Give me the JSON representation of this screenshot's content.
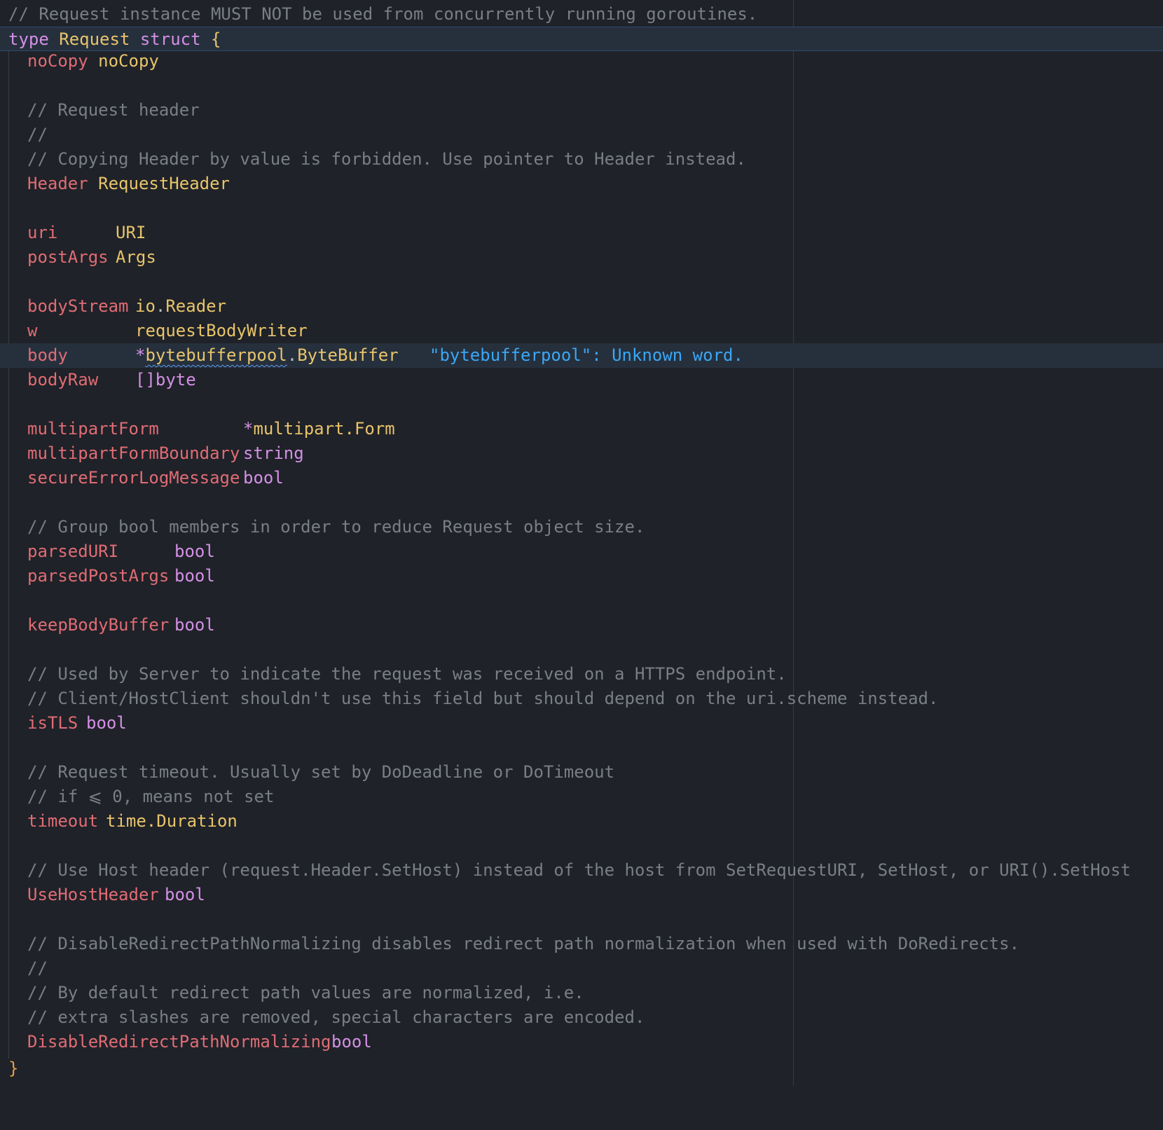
{
  "editor": {
    "theme_colors": {
      "background": "#1f2228",
      "comment": "#7a7e85",
      "keyword": "#d490e6",
      "type": "#e8c46b",
      "field": "#e06c75",
      "inline_hint": "#3aa7f5",
      "caret_line": "#26303d"
    },
    "lines": {
      "l01": "// Request instance MUST NOT be used from concurrently running goroutines.",
      "l02_kw": "type",
      "l02_name": "Request",
      "l02_struct": "struct",
      "l02_brace": "{",
      "l03_field": "noCopy",
      "l03_type": "noCopy",
      "l05": "// Request header",
      "l06": "//",
      "l07": "// Copying Header by value is forbidden. Use pointer to Header instead.",
      "l08_field": "Header",
      "l08_type": "RequestHeader",
      "l10_field": "uri",
      "l10_type": "URI",
      "l11_field": "postArgs",
      "l11_type": "Args",
      "l13_field": "bodyStream",
      "l13_pkg": "io",
      "l13_dot": ".",
      "l13_type": "Reader",
      "l14_field": "w",
      "l14_type": "requestBodyWriter",
      "l15_field": "body",
      "l15_ptr": "*",
      "l15_pkg": "bytebufferpool",
      "l15_dot": ".",
      "l15_type": "ByteBuffer",
      "l15_hint": "\"bytebufferpool\": Unknown word.",
      "l16_field": "bodyRaw",
      "l16_type": "[]byte",
      "l18_field": "multipartForm",
      "l18_ptr": "*",
      "l18_type": "multipart.Form",
      "l19_field": "multipartFormBoundary",
      "l19_type": "string",
      "l20_field": "secureErrorLogMessage",
      "l20_type": "bool",
      "l22": "// Group bool members in order to reduce Request object size.",
      "l23_field": "parsedURI",
      "l23_type": "bool",
      "l24_field": "parsedPostArgs",
      "l24_type": "bool",
      "l26_field": "keepBodyBuffer",
      "l26_type": "bool",
      "l28": "// Used by Server to indicate the request was received on a HTTPS endpoint.",
      "l29": "// Client/HostClient shouldn't use this field but should depend on the uri.scheme instead.",
      "l30_field": "isTLS",
      "l30_type": "bool",
      "l32": "// Request timeout. Usually set by DoDeadline or DoTimeout",
      "l33": "// if ⩽ 0, means not set",
      "l34_field": "timeout",
      "l34_type": "time.Duration",
      "l36": "// Use Host header (request.Header.SetHost) instead of the host from SetRequestURI, SetHost, or URI().SetHost",
      "l37_field": "UseHostHeader",
      "l37_type": "bool",
      "l39": "// DisableRedirectPathNormalizing disables redirect path normalization when used with DoRedirects.",
      "l40": "//",
      "l41": "// By default redirect path values are normalized, i.e.",
      "l42": "// extra slashes are removed, special characters are encoded.",
      "l43_field": "DisableRedirectPathNormalizing",
      "l43_type": "bool",
      "l44": "}"
    }
  }
}
